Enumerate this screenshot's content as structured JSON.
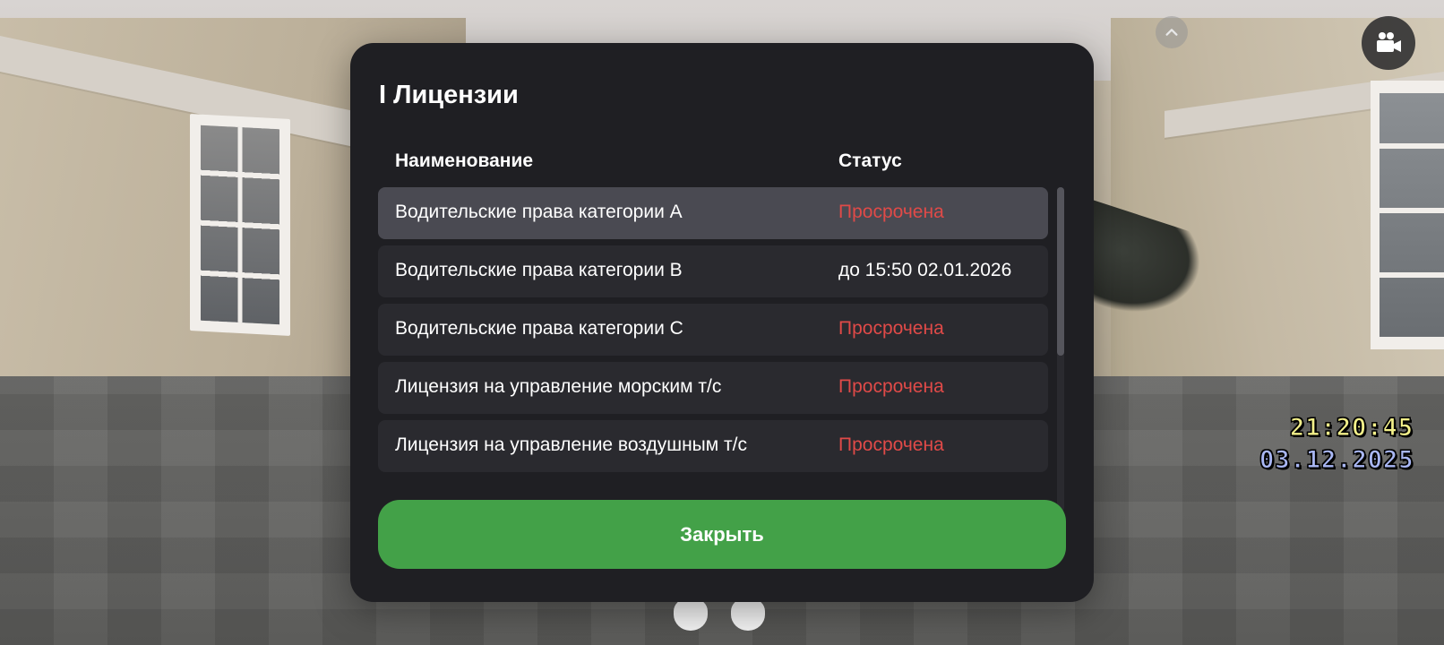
{
  "hud": {
    "time": "21:20:45",
    "date": "03.12.2025",
    "icons": {
      "collapse": "chevron-up-icon",
      "camera": "video-camera-icon"
    }
  },
  "modal": {
    "title": "I Лицензии",
    "columns": {
      "name": "Наименование",
      "status": "Статус"
    },
    "rows": [
      {
        "name": "Водительские права категории А",
        "status": "Просрочена",
        "expired": true,
        "selected": true
      },
      {
        "name": "Водительские права категории В",
        "status": "до 15:50 02.01.2026",
        "expired": false,
        "selected": false
      },
      {
        "name": "Водительские права категории С",
        "status": "Просрочена",
        "expired": true,
        "selected": false
      },
      {
        "name": "Лицензия на управление морским т/с",
        "status": "Просрочена",
        "expired": true,
        "selected": false
      },
      {
        "name": "Лицензия на управление воздушным т/с",
        "status": "Просрочена",
        "expired": true,
        "selected": false
      }
    ],
    "close_label": "Закрыть"
  },
  "colors": {
    "modal_bg": "#1f1f23",
    "row_bg": "#2a2a2f",
    "row_selected_bg": "#4a4a52",
    "expired": "#e04a48",
    "close_button": "#43a148",
    "hud_time": "#f3f08a",
    "hud_date": "#a9b7f4"
  }
}
